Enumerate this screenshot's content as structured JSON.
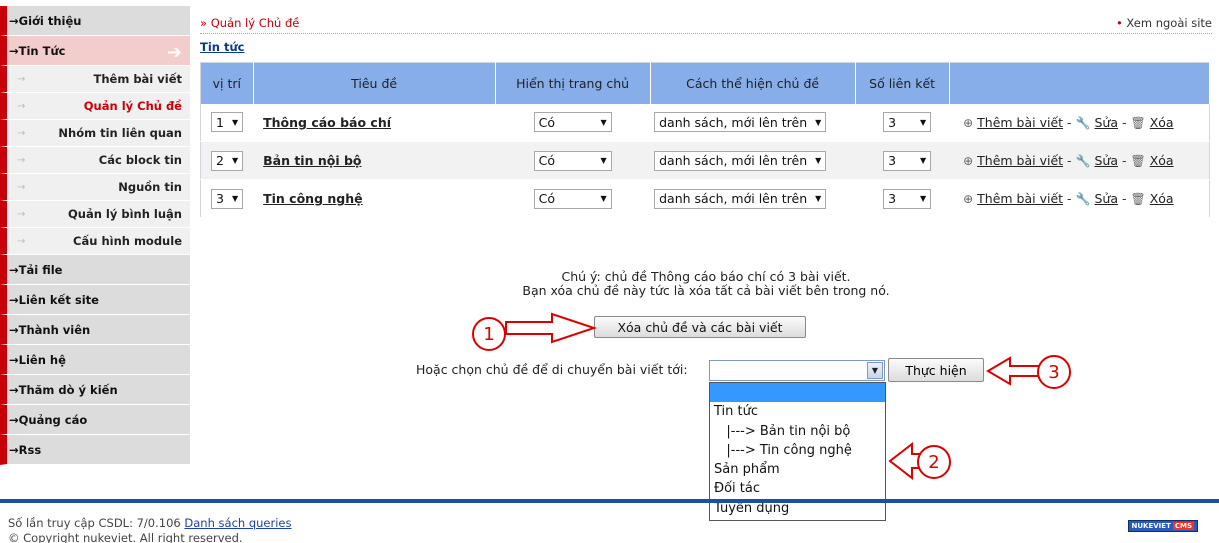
{
  "sidebar": {
    "items": [
      {
        "label": "Giới thiệu",
        "type": "main"
      },
      {
        "label": "Tin Tức",
        "type": "main-active"
      },
      {
        "label": "Thêm bài viết",
        "type": "sub"
      },
      {
        "label": "Quản lý Chủ đề",
        "type": "sub-current"
      },
      {
        "label": "Nhóm tin liên quan",
        "type": "sub"
      },
      {
        "label": "Các block tin",
        "type": "sub"
      },
      {
        "label": "Nguồn tin",
        "type": "sub"
      },
      {
        "label": "Quản lý bình luận",
        "type": "sub"
      },
      {
        "label": "Cấu hình module",
        "type": "sub"
      },
      {
        "label": "Tải file",
        "type": "main"
      },
      {
        "label": "Liên kết site",
        "type": "main"
      },
      {
        "label": "Thành viên",
        "type": "main"
      },
      {
        "label": "Liên hệ",
        "type": "main"
      },
      {
        "label": "Thăm dò ý kiến",
        "type": "main"
      },
      {
        "label": "Quảng cáo",
        "type": "main"
      },
      {
        "label": "Rss",
        "type": "main"
      }
    ],
    "main_arrow": "→",
    "active_arrow": "➔",
    "sub_arrow": "→"
  },
  "header": {
    "crumb_prefix": "»",
    "crumb": "Quản lý Chủ đề",
    "view_site_bullet": "•",
    "view_site": "Xem ngoài site",
    "tab_link": "Tin tức"
  },
  "table": {
    "headers": [
      "vị trí",
      "Tiêu đề",
      "Hiển thị trang chủ",
      "Cách thể hiện chủ đề",
      "Số liên kết",
      ""
    ],
    "rows": [
      {
        "position": "1",
        "title": "Thông cáo báo chí",
        "show_home": "Có",
        "display": "danh sách, mới lên trên",
        "links": "3"
      },
      {
        "position": "2",
        "title": "Bản tin nội bộ",
        "show_home": "Có",
        "display": "danh sách, mới lên trên",
        "links": "3"
      },
      {
        "position": "3",
        "title": "Tin công nghệ",
        "show_home": "Có",
        "display": "danh sách, mới lên trên",
        "links": "3"
      }
    ],
    "actions": {
      "add": "Thêm bài viết",
      "edit": "Sửa",
      "delete": "Xóa",
      "sep": "-"
    },
    "icons": {
      "add": "plus-circle-icon",
      "edit": "wrench-icon",
      "delete": "trash-icon"
    }
  },
  "notice": {
    "line1": "Chú ý: chủ đề Thông cáo báo chí có 3 bài viết.",
    "line2": "Bạn xóa chủ đề này tức là xóa tất cả bài viết bên trong nó."
  },
  "delete_button": "Xóa chủ đề và các bài viết",
  "move": {
    "label": "Hoặc chọn chủ đề để di chuyển bài viết tới:",
    "selected": "",
    "button": "Thực hiện",
    "options": [
      "",
      "Tin tức",
      "   |---> Bản tin nội bộ",
      "   |---> Tin công nghệ",
      "Sản phẩm",
      "Đối tác",
      "Tuyển dụng"
    ]
  },
  "callouts": [
    "1",
    "2",
    "3"
  ],
  "footer": {
    "queries_text": "Số lần truy cập CSDL: 7/0.106",
    "queries_link": "Danh sách queries",
    "copyright": "© Copyright nukeviet. All right reserved.",
    "badge_main": "NUKEVIET",
    "badge_cms": "CMS"
  },
  "colors": {
    "accent_red": "#c8000a",
    "table_header": "#87aee8",
    "footer_line": "#1f4fa0",
    "callout_red": "#dd0000",
    "highlight": "#3399ff"
  }
}
